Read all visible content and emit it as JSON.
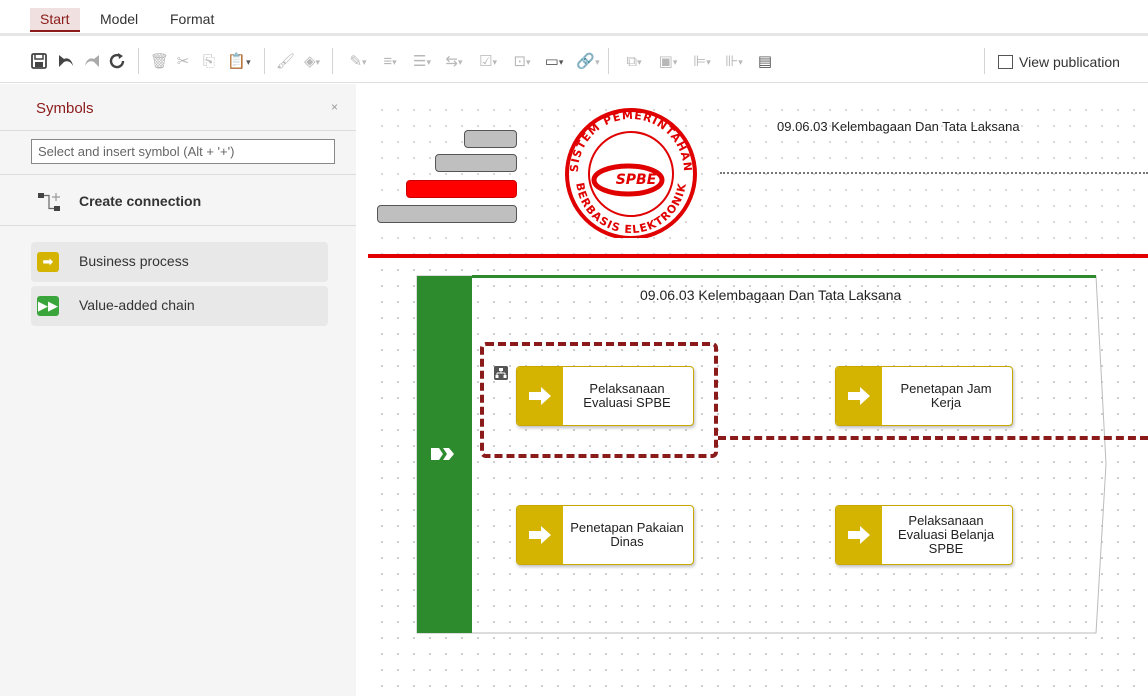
{
  "menu": {
    "tabs": [
      "Start",
      "Model",
      "Format"
    ],
    "active": "Start"
  },
  "toolbar": {
    "view_publication_label": "View publication"
  },
  "sidebar": {
    "title": "Symbols",
    "close_glyph": "×",
    "search_placeholder": "Select and insert symbol (Alt + '+')",
    "create_connection_label": "Create connection",
    "symbols": [
      {
        "label": "Business process",
        "color": "#d4b400",
        "icon": "arrow-icon"
      },
      {
        "label": "Value-added chain",
        "color": "#3aa53a",
        "icon": "chevron-icon"
      }
    ]
  },
  "canvas": {
    "header_title": "09.06.03 Kelembagaan Dan Tata Laksana",
    "logo": {
      "top_text": "SISTEM PEMERINTAHAN",
      "center_text": "SPBE",
      "bottom_text": "BERBASIS ELEKTRONIK",
      "color": "#e00000"
    },
    "pool_title": "09.06.03 Kelembagaan Dan Tata Laksana",
    "processes": [
      {
        "label": "Pelaksanaan Evaluasi SPBE"
      },
      {
        "label": "Penetapan Jam Kerja"
      },
      {
        "label": "Penetapan Pakaian Dinas"
      },
      {
        "label": "Pelaksanaan Evaluasi Belanja SPBE"
      }
    ]
  },
  "colors": {
    "accent": "#8b1a1a",
    "pool_green": "#2d8a2d",
    "process_yellow": "#d4b400",
    "header_red": "#e00000"
  }
}
